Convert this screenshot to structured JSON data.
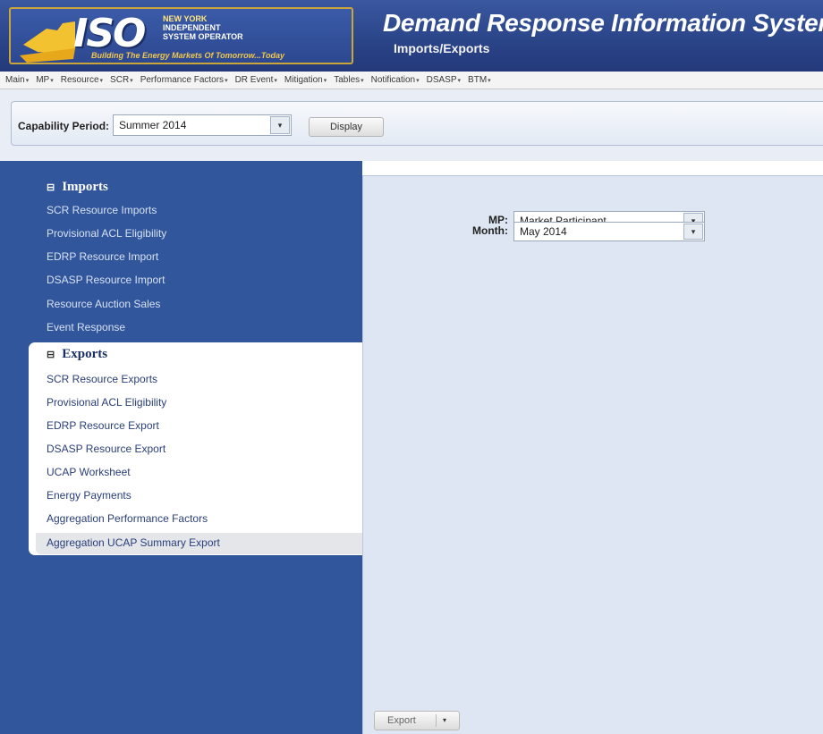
{
  "header": {
    "logo_text": "ISO",
    "logo_subtitle": [
      "NEW YORK",
      "INDEPENDENT",
      "SYSTEM OPERATOR"
    ],
    "logo_tagline": "Building The Energy Markets Of Tomorrow...Today",
    "system_title": "Demand Response Information System",
    "page_subtitle": "Imports/Exports"
  },
  "menu": {
    "items": [
      "Main",
      "MP",
      "Resource",
      "SCR",
      "Performance Factors",
      "DR Event",
      "Mitigation",
      "Tables",
      "Notification",
      "DSASP",
      "BTM"
    ],
    "caret": "▾"
  },
  "toolbar": {
    "capability_label": "Capability Period:",
    "capability_value": "Summer 2014",
    "display_label": "Display"
  },
  "sidebar": {
    "imports": {
      "title": "Imports",
      "toggle": "⊟",
      "items": [
        "SCR Resource Imports",
        "Provisional ACL Eligibility",
        "EDRP Resource Import",
        "DSASP Resource Import",
        "Resource Auction Sales",
        "Event Response"
      ]
    },
    "exports": {
      "title": "Exports",
      "toggle": "⊟",
      "items": [
        "SCR Resource Exports",
        "Provisional ACL Eligibility",
        "EDRP Resource Export",
        "DSASP Resource Export",
        "UCAP Worksheet",
        "Energy Payments",
        "Aggregation Performance Factors",
        "Aggregation UCAP Summary Export"
      ]
    }
  },
  "form": {
    "mp_label": "MP:",
    "mp_value": "Market Participant",
    "month_label": "Month:",
    "month_value": "May 2014",
    "dropdown_glyph": "▾"
  },
  "export_button": {
    "label": "Export",
    "caret": "▾"
  },
  "colors": {
    "header_blue": "#2b4589",
    "sidebar_blue": "#31569b",
    "main_panel": "#dde6f2",
    "logo_border": "#c9a53a"
  }
}
